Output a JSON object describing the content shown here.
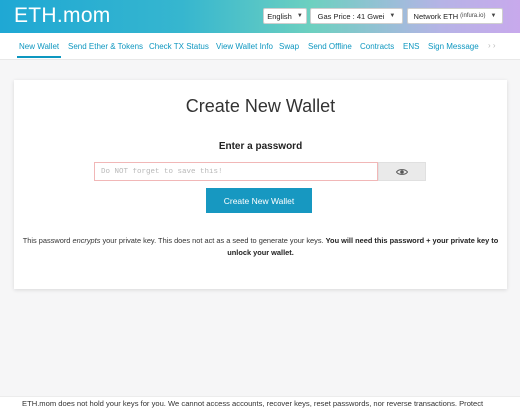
{
  "header": {
    "logo": "ETH.mom",
    "language": "English",
    "gas_price": "Gas Price : 41 Gwei",
    "network": "Network ETH",
    "network_sub": "(infura.io)"
  },
  "nav": {
    "items": [
      "New Wallet",
      "Send Ether & Tokens",
      "Check TX Status",
      "View Wallet Info",
      "Swap",
      "Send Offline",
      "Contracts",
      "ENS",
      "Sign Message"
    ],
    "more": "› ›"
  },
  "main": {
    "title": "Create New Wallet",
    "password_label": "Enter a password",
    "password_placeholder": "Do NOT forget to save this!",
    "create_button": "Create New Wallet",
    "note_part1": "This password ",
    "note_em": "encrypts",
    "note_part2": " your private key. This does not act as a seed to generate your keys. ",
    "note_bold": "You will need this password + your private key to unlock your wallet."
  },
  "footer": {
    "text": "ETH.mom does not hold your keys for you. We cannot access accounts, recover keys, reset passwords, nor reverse transactions. Protect"
  },
  "colors": {
    "accent": "#1798c1",
    "nav_link": "#0e97c0",
    "input_border_error": "#f1b7b7"
  },
  "icons": {
    "eye": "eye-icon",
    "caret": "caret-down-icon"
  }
}
